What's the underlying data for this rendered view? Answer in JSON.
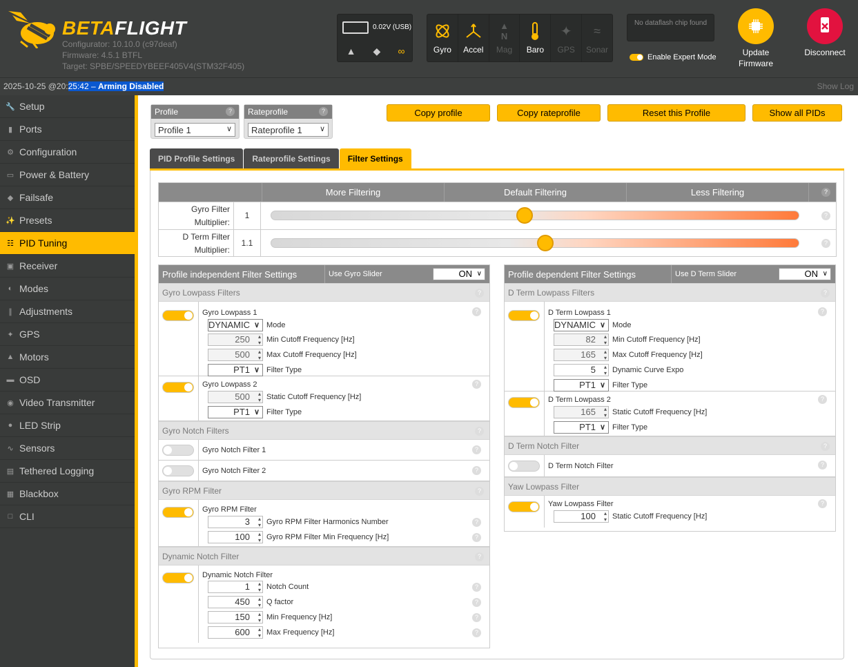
{
  "header": {
    "brand_main": "BETA",
    "brand_suffix": "FLIGHT",
    "configurator": "Configurator: 10.10.0 (c97deaf)",
    "firmware": "Firmware: 4.5.1 BTFL",
    "target": "Target: SPBE/SPEEDYBEEF405V4(STM32F405)",
    "voltage": "0.02V (USB)",
    "sensors": [
      {
        "label": "Gyro",
        "icon": "gyro-icon",
        "active": true
      },
      {
        "label": "Accel",
        "icon": "accel-icon",
        "active": true
      },
      {
        "label": "Mag",
        "icon": "mag-icon",
        "active": false
      },
      {
        "label": "Baro",
        "icon": "baro-icon",
        "active": true
      },
      {
        "label": "GPS",
        "icon": "gps-icon",
        "active": false
      },
      {
        "label": "Sonar",
        "icon": "sonar-icon",
        "active": false
      }
    ],
    "dataflash": "No dataflash chip found",
    "expert_mode": "Enable Expert Mode",
    "update_firmware": "Update Firmware",
    "disconnect": "Disconnect",
    "accent": "#ffbb00",
    "disconnect_color": "#e2123f"
  },
  "statusbar": {
    "date_prefix": "2025-10-25 @20:",
    "date_highlight": "25:42 – ",
    "arming": "Arming Disabled",
    "show_log": "Show Log"
  },
  "nav": [
    {
      "label": "Setup",
      "icon": "wrench-icon"
    },
    {
      "label": "Ports",
      "icon": "plug-icon"
    },
    {
      "label": "Configuration",
      "icon": "gear-icon"
    },
    {
      "label": "Power & Battery",
      "icon": "battery-icon"
    },
    {
      "label": "Failsafe",
      "icon": "parachute-icon"
    },
    {
      "label": "Presets",
      "icon": "magic-wand-icon"
    },
    {
      "label": "PID Tuning",
      "icon": "sitemap-icon",
      "active": true
    },
    {
      "label": "Receiver",
      "icon": "gamepad-icon"
    },
    {
      "label": "Modes",
      "icon": "toggle-icon"
    },
    {
      "label": "Adjustments",
      "icon": "sliders-icon"
    },
    {
      "label": "GPS",
      "icon": "satellite-icon"
    },
    {
      "label": "Motors",
      "icon": "motor-icon"
    },
    {
      "label": "OSD",
      "icon": "osd-icon"
    },
    {
      "label": "Video Transmitter",
      "icon": "broadcast-icon"
    },
    {
      "label": "LED Strip",
      "icon": "led-icon"
    },
    {
      "label": "Sensors",
      "icon": "pulse-icon"
    },
    {
      "label": "Tethered Logging",
      "icon": "log-icon"
    },
    {
      "label": "Blackbox",
      "icon": "blackbox-icon"
    },
    {
      "label": "CLI",
      "icon": "terminal-icon"
    }
  ],
  "profile": {
    "head": "Profile",
    "value": "Profile 1"
  },
  "rateprofile": {
    "head": "Rateprofile",
    "value": "Rateprofile 1"
  },
  "buttons": {
    "copy_profile": "Copy profile",
    "copy_rateprofile": "Copy rateprofile",
    "reset_profile": "Reset this Profile",
    "show_all_pids": "Show all PIDs"
  },
  "tabs": [
    "PID Profile Settings",
    "Rateprofile Settings",
    "Filter Settings"
  ],
  "slider_head": [
    "More Filtering",
    "Default Filtering",
    "Less Filtering"
  ],
  "sliders": [
    {
      "label1": "Gyro Filter",
      "label2": "Multiplier:",
      "value": "1",
      "position": 0.48
    },
    {
      "label1": "D Term Filter",
      "label2": "Multiplier:",
      "value": "1.1",
      "position": 0.52
    }
  ],
  "left_panel": {
    "title": "Profile independent Filter Settings",
    "use_slider": "Use Gyro Slider",
    "use_slider_value": "ON",
    "gyro_lowpass_section": "Gyro Lowpass Filters",
    "lp1_title": "Gyro Lowpass 1",
    "lp1_mode": "DYNAMIC",
    "lp1_mode_label": "Mode",
    "lp1_min": "250",
    "lp1_min_label": "Min Cutoff Frequency [Hz]",
    "lp1_max": "500",
    "lp1_max_label": "Max Cutoff Frequency [Hz]",
    "lp1_type": "PT1",
    "lp1_type_label": "Filter Type",
    "lp2_title": "Gyro Lowpass 2",
    "lp2_static": "500",
    "lp2_static_label": "Static Cutoff Frequency [Hz]",
    "lp2_type": "PT1",
    "lp2_type_label": "Filter Type",
    "notch_section": "Gyro Notch Filters",
    "notch1": "Gyro Notch Filter 1",
    "notch2": "Gyro Notch Filter 2",
    "rpm_section": "Gyro RPM Filter",
    "rpm_title": "Gyro RPM Filter",
    "rpm_harmonics": "3",
    "rpm_harmonics_label": "Gyro RPM Filter Harmonics Number",
    "rpm_min": "100",
    "rpm_min_label": "Gyro RPM Filter Min Frequency [Hz]",
    "dyn_section": "Dynamic Notch Filter",
    "dyn_title": "Dynamic Notch Filter",
    "dyn_count": "1",
    "dyn_count_label": "Notch Count",
    "dyn_q": "450",
    "dyn_q_label": "Q factor",
    "dyn_min": "150",
    "dyn_min_label": "Min Frequency [Hz]",
    "dyn_max": "600",
    "dyn_max_label": "Max Frequency [Hz]"
  },
  "right_panel": {
    "title": "Profile dependent Filter Settings",
    "use_slider": "Use D Term Slider",
    "use_slider_value": "ON",
    "dlp_section": "D Term Lowpass Filters",
    "dlp1_title": "D Term Lowpass 1",
    "dlp1_mode": "DYNAMIC",
    "dlp1_mode_label": "Mode",
    "dlp1_min": "82",
    "dlp1_min_label": "Min Cutoff Frequency [Hz]",
    "dlp1_max": "165",
    "dlp1_max_label": "Max Cutoff Frequency [Hz]",
    "dlp1_expo": "5",
    "dlp1_expo_label": "Dynamic Curve Expo",
    "dlp1_type": "PT1",
    "dlp1_type_label": "Filter Type",
    "dlp2_title": "D Term Lowpass 2",
    "dlp2_static": "165",
    "dlp2_static_label": "Static Cutoff Frequency [Hz]",
    "dlp2_type": "PT1",
    "dlp2_type_label": "Filter Type",
    "dnotch_section": "D Term Notch Filter",
    "dnotch_title": "D Term Notch Filter",
    "yaw_section": "Yaw Lowpass Filter",
    "yaw_title": "Yaw Lowpass Filter",
    "yaw_static": "100",
    "yaw_static_label": "Static Cutoff Frequency [Hz]"
  }
}
